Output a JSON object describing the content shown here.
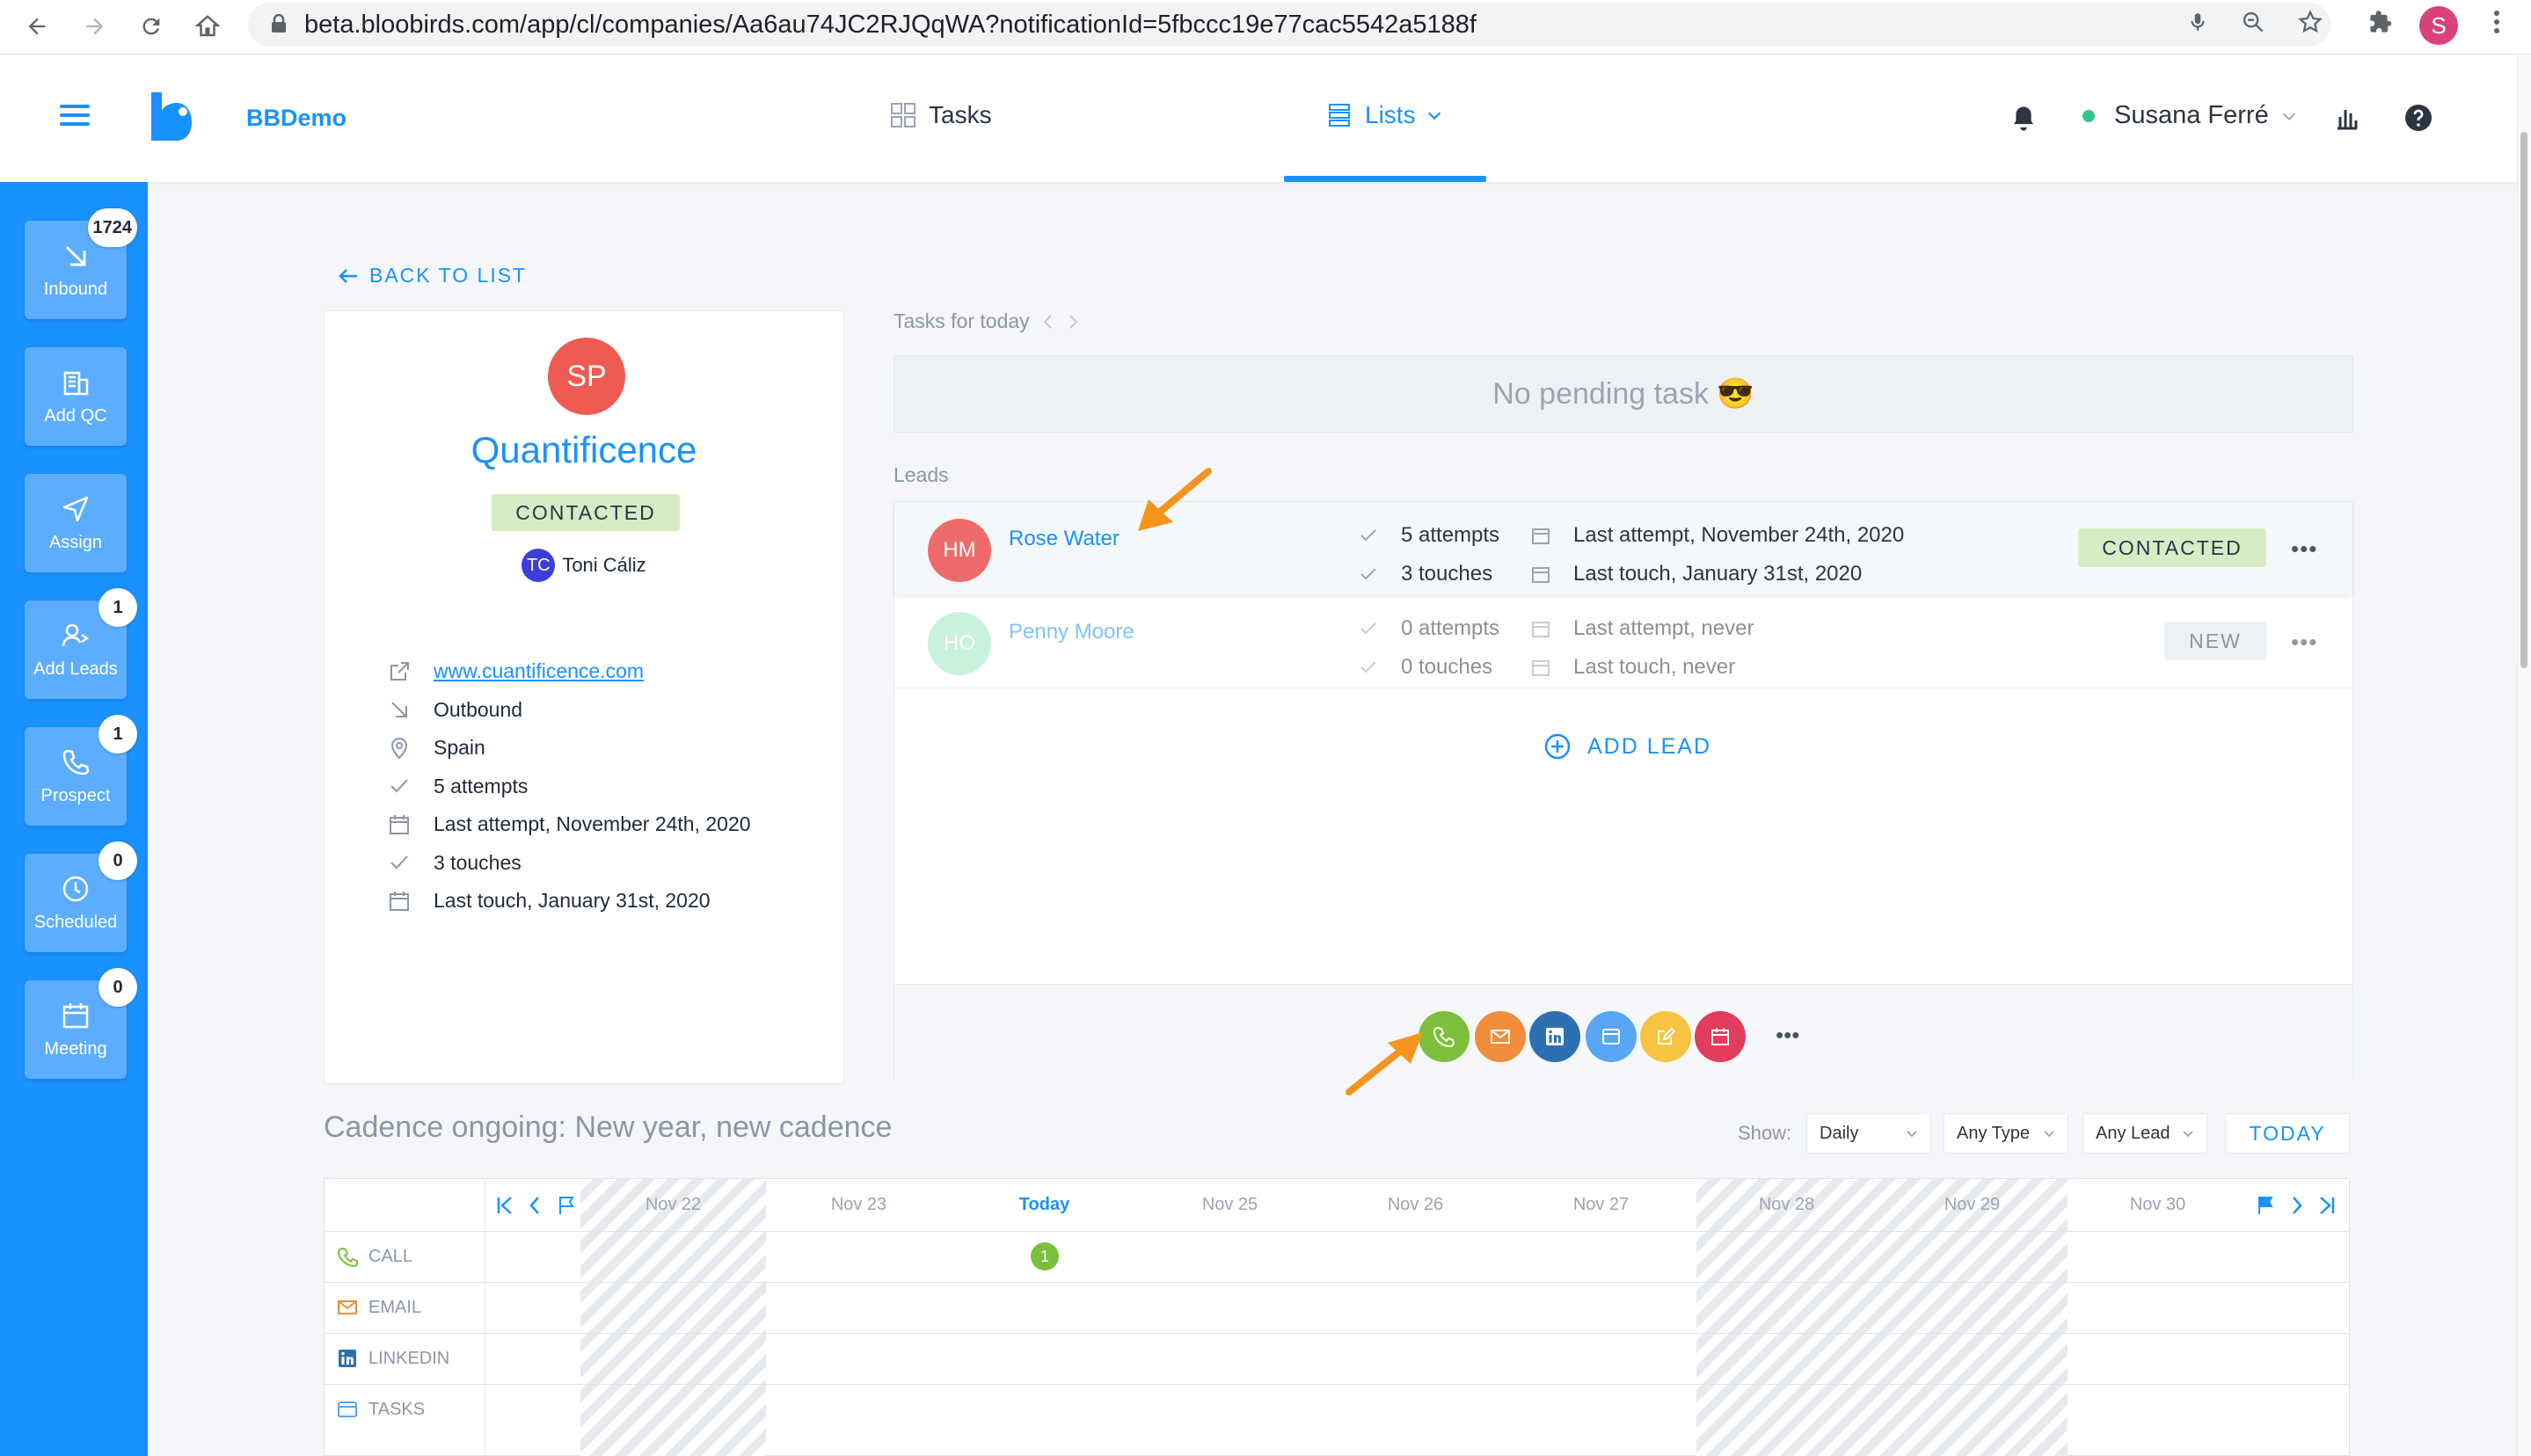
{
  "browser": {
    "url": "beta.bloobirds.com/app/cl/companies/Aa6au74JC2RJQqWA?notificationId=5fbccc19e77cac5542a5188f",
    "profile_initial": "S"
  },
  "header": {
    "workspace": "BBDemo",
    "nav_tasks": "Tasks",
    "nav_lists": "Lists",
    "user_name": "Susana Ferré"
  },
  "sidebar": {
    "items": [
      {
        "label": "Inbound",
        "badge": "1724",
        "icon": "arrow-down-right-icon"
      },
      {
        "label": "Add QC",
        "badge": "",
        "icon": "building-icon"
      },
      {
        "label": "Assign",
        "badge": "",
        "icon": "send-icon"
      },
      {
        "label": "Add Leads",
        "badge": "1",
        "icon": "add-person-icon"
      },
      {
        "label": "Prospect",
        "badge": "1",
        "icon": "phone-icon"
      },
      {
        "label": "Scheduled",
        "badge": "0",
        "icon": "clock-icon"
      },
      {
        "label": "Meeting",
        "badge": "0",
        "icon": "calendar-icon"
      }
    ]
  },
  "back_to_list": "BACK TO LIST",
  "company": {
    "initials": "SP",
    "name": "Quantificence",
    "status": "CONTACTED",
    "owner_initials": "TC",
    "owner_name": "Toni Cáliz",
    "website": "www.cuantificence.com",
    "source": "Outbound",
    "country": "Spain",
    "attempts": "5 attempts",
    "last_attempt": "Last attempt, November 24th, 2020",
    "touches": "3 touches",
    "last_touch": "Last touch, January 31st, 2020"
  },
  "tasks": {
    "title": "Tasks for today",
    "empty_text": "No pending task 😎"
  },
  "leads": {
    "title": "Leads",
    "items": [
      {
        "initials": "HM",
        "name": "Rose Water",
        "attempts": "5 attempts",
        "touches": "3 touches",
        "last_attempt": "Last attempt, November 24th, 2020",
        "last_touch": "Last touch, January 31st, 2020",
        "status": "CONTACTED"
      },
      {
        "initials": "HO",
        "name": "Penny Moore",
        "attempts": "0 attempts",
        "touches": "0 touches",
        "last_attempt": "Last attempt, never",
        "last_touch": "Last touch, never",
        "status": "NEW"
      }
    ],
    "add_lead": "ADD LEAD",
    "more": "•••"
  },
  "actions": {
    "colors": {
      "call": "#7bbf3a",
      "email": "#f08c3a",
      "linkedin": "#2d6fb3",
      "task": "#5aa5f5",
      "note": "#f6c342",
      "meeting": "#e23c5e"
    },
    "more": "•••"
  },
  "cadence": {
    "title": "Cadence ongoing: New year, new cadence",
    "show_label": "Show:",
    "filter_period": "Daily",
    "filter_type": "Any Type",
    "filter_lead": "Any Lead",
    "today_button": "TODAY",
    "days": [
      "Nov 22",
      "Nov 23",
      "Today",
      "Nov 25",
      "Nov 26",
      "Nov 27",
      "Nov 28",
      "Nov 29",
      "Nov 30"
    ],
    "rows": [
      "CALL",
      "EMAIL",
      "LINKEDIN",
      "TASKS"
    ],
    "call_today_count": "1"
  }
}
